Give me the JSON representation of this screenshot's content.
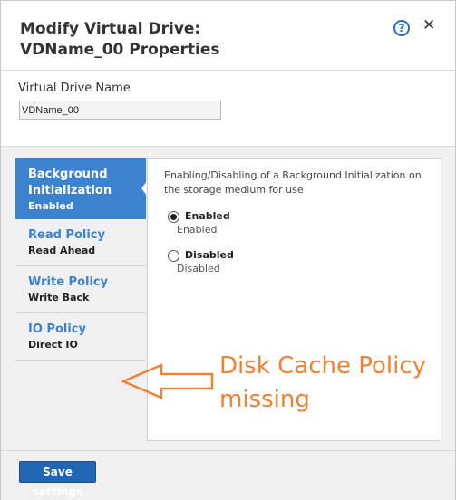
{
  "dialog": {
    "title_line1": "Modify Virtual Drive:",
    "title_line2": "VDName_00 Properties",
    "help_icon": "question-circle-icon",
    "close_icon": "close-icon"
  },
  "name_field": {
    "label": "Virtual Drive Name",
    "value": "VDName_00"
  },
  "nav": {
    "items": [
      {
        "title": "Background Initialization",
        "value": "Enabled",
        "active": true
      },
      {
        "title": "Read Policy",
        "value": "Read Ahead",
        "active": false
      },
      {
        "title": "Write Policy",
        "value": "Write Back",
        "active": false
      },
      {
        "title": "IO Policy",
        "value": "Direct IO",
        "active": false
      }
    ]
  },
  "panel": {
    "description": "Enabling/Disabling of a Background Initialization on the storage medium for use",
    "options": [
      {
        "label": "Enabled",
        "sublabel": "Enabled",
        "selected": true
      },
      {
        "label": "Disabled",
        "sublabel": "Disabled",
        "selected": false
      }
    ]
  },
  "annotation": {
    "line1": "Disk Cache Policy",
    "line2": "missing",
    "color": "#f08232",
    "icon": "left-arrow-outline-icon"
  },
  "footer": {
    "save_label": "Save settings"
  },
  "colors": {
    "accent": "#3d82ce",
    "button": "#2066b4",
    "annotation": "#f08232"
  }
}
